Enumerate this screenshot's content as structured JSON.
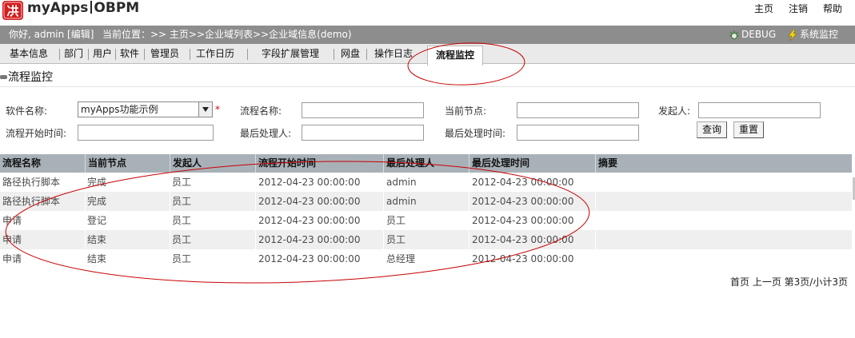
{
  "header": {
    "logo_text": "㓋",
    "app_name": "myApps",
    "app_suffix": "OBPM",
    "links": [
      "主页",
      "注销",
      "帮助"
    ]
  },
  "infobar": {
    "greeting": "你好, admin [编辑]",
    "location": "当前位置：>> 主页>>企业域列表>>企业域信息(demo)",
    "debug_label": "DEBUG",
    "sysmon_label": "系统监控"
  },
  "tabs": {
    "items": [
      "基本信息",
      "部门",
      "用户",
      "软件",
      "管理员",
      "工作日历",
      "字段扩展管理",
      "网盘",
      "操作日志"
    ],
    "active": "流程监控"
  },
  "page_title": "流程监控",
  "filters": {
    "software_label": "软件名称:",
    "software_value": "myApps功能示例",
    "required_mark": "*",
    "flow_name_label": "流程名称:",
    "current_node_label": "当前节点:",
    "initiator_label": "发起人:",
    "start_time_label": "流程开始时间:",
    "last_handler_label": "最后处理人:",
    "last_time_label": "最后处理时间:",
    "query_button": "查询",
    "reset_button": "重置"
  },
  "table": {
    "columns": [
      "流程名称",
      "当前节点",
      "发起人",
      "流程开始时间",
      "最后处理人",
      "最后处理时间",
      "摘要"
    ],
    "rows": [
      [
        "路径执行脚本",
        "完成",
        "员工",
        "2012-04-23 00:00:00",
        "admin",
        "2012-04-23 00:00:00",
        ""
      ],
      [
        "路径执行脚本",
        "完成",
        "员工",
        "2012-04-23 00:00:00",
        "admin",
        "2012-04-23 00:00:00",
        ""
      ],
      [
        "申请",
        "登记",
        "员工",
        "2012-04-23 00:00:00",
        "员工",
        "2012-04-23 00:00:00",
        ""
      ],
      [
        "申请",
        "结束",
        "员工",
        "2012-04-23 00:00:00",
        "员工",
        "2012-04-23 00:00:00",
        ""
      ],
      [
        "申请",
        "结束",
        "员工",
        "2012-04-23 00:00:00",
        "总经理",
        "2012-04-23 00:00:00",
        ""
      ]
    ]
  },
  "pager": {
    "first": "首页",
    "prev": "上一页",
    "status": "第3页/小计3页"
  },
  "colors": {
    "infobar_bg": "#8d8d8d",
    "table_header_bg": "#a9b1b8",
    "annotation_red": "#c80000"
  }
}
